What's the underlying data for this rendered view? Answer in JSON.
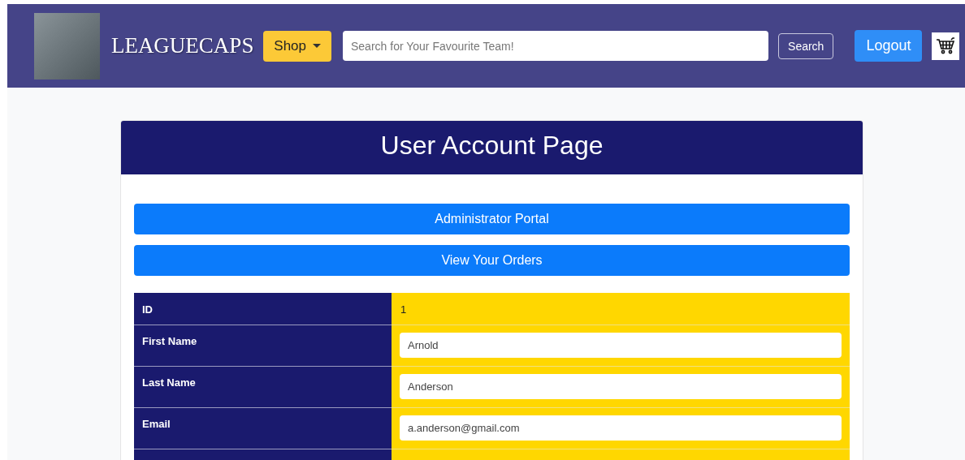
{
  "navbar": {
    "brand": "LEAGUECAPS",
    "shop_menu": "Shop",
    "search": {
      "placeholder": "Search for Your Favourite Team!"
    },
    "search_button": "Search",
    "logout_button": "Logout"
  },
  "page": {
    "title": "User Account Page",
    "actions": [
      "Administrator Portal",
      "View Your Orders"
    ],
    "fields": [
      {
        "kind": "text",
        "label": "ID",
        "value": "1"
      },
      {
        "kind": "input",
        "label": "First Name",
        "value": "Arnold"
      },
      {
        "kind": "input",
        "label": "Last Name",
        "value": "Anderson"
      },
      {
        "kind": "input",
        "label": "Email",
        "value": "a.anderson@gmail.com"
      }
    ]
  }
}
